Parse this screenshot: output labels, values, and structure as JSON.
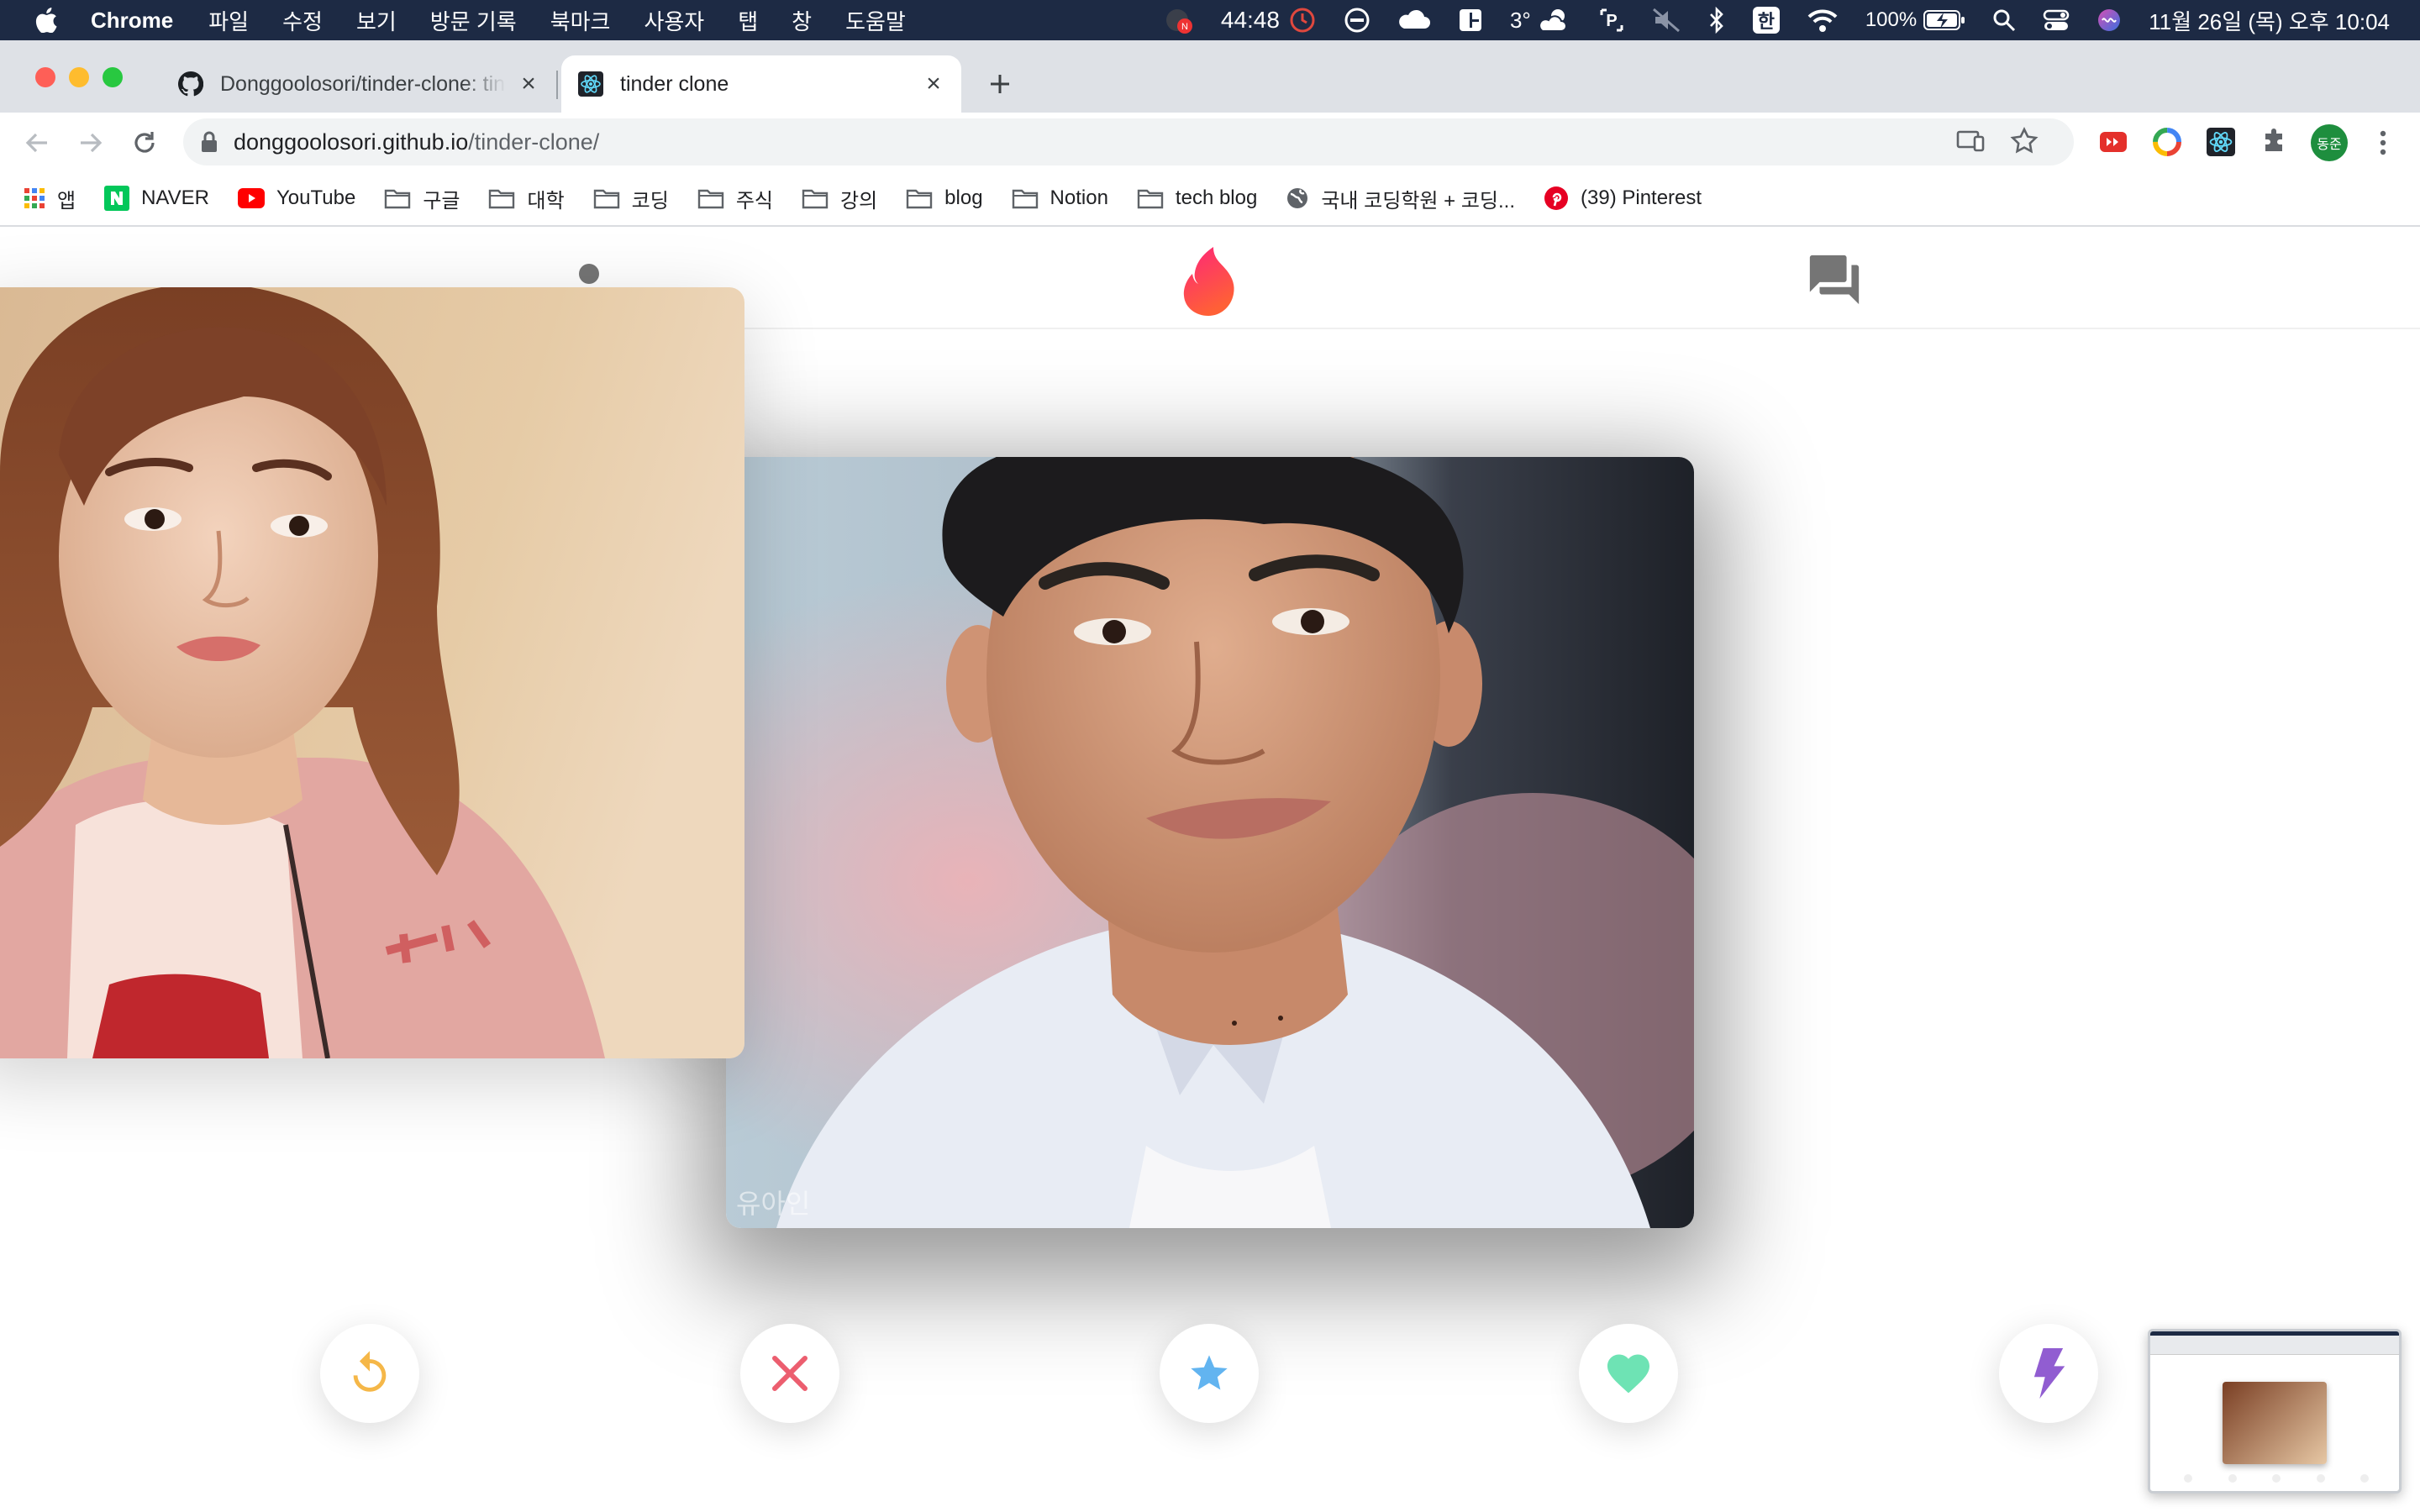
{
  "menubar": {
    "app_name": "Chrome",
    "menus": [
      "파일",
      "수정",
      "보기",
      "방문 기록",
      "북마크",
      "사용자",
      "탭",
      "창",
      "도움말"
    ],
    "timer": "44:48",
    "temperature": "3°",
    "ime": "한",
    "battery": "100%",
    "datetime": "11월 26일 (목) 오후 10:04"
  },
  "tabs": [
    {
      "title": "Donggoolosori/tinder-clone: tinder",
      "favicon": "github-icon",
      "active": false
    },
    {
      "title": "tinder clone",
      "favicon": "react-icon",
      "active": true
    }
  ],
  "address": {
    "domain": "donggoolosori.github.io",
    "path": "/tinder-clone/"
  },
  "profile_badge": "동준",
  "bookmarks": [
    {
      "label": "앱",
      "icon": "apps-grid-icon"
    },
    {
      "label": "NAVER",
      "icon": "naver-icon"
    },
    {
      "label": "YouTube",
      "icon": "youtube-icon"
    },
    {
      "label": "구글",
      "icon": "folder-icon"
    },
    {
      "label": "대학",
      "icon": "folder-icon"
    },
    {
      "label": "코딩",
      "icon": "folder-icon"
    },
    {
      "label": "주식",
      "icon": "folder-icon"
    },
    {
      "label": "강의",
      "icon": "folder-icon"
    },
    {
      "label": "blog",
      "icon": "folder-icon"
    },
    {
      "label": "Notion",
      "icon": "folder-icon"
    },
    {
      "label": "tech blog",
      "icon": "folder-icon"
    },
    {
      "label": "국내 코딩학원 + 코딩...",
      "icon": "globe-icon"
    },
    {
      "label": "(39) Pinterest",
      "icon": "pinterest-icon"
    }
  ],
  "app": {
    "colors": {
      "flame": "#fd5068",
      "replay": "#f5b748",
      "nope": "#ec5e6f",
      "superlike": "#62b4f0",
      "like": "#6ee3b4",
      "boost": "#915dd1"
    },
    "cards": [
      {
        "name": "유아인",
        "photo": "man-portrait"
      },
      {
        "name": "",
        "photo": "woman-portrait"
      }
    ],
    "buttons": [
      "replay-icon",
      "close-icon",
      "star-icon",
      "heart-icon",
      "bolt-icon"
    ]
  }
}
